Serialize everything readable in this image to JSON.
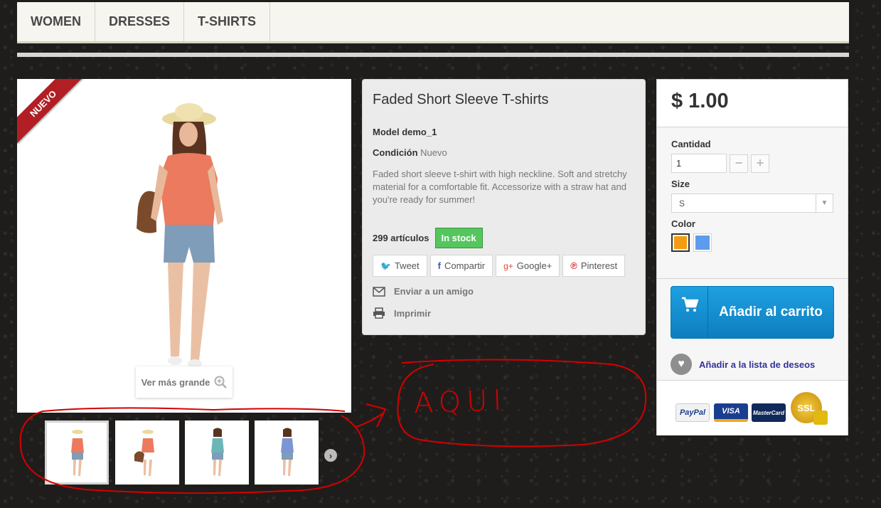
{
  "menu": {
    "items": [
      {
        "label": "WOMEN"
      },
      {
        "label": "DRESSES"
      },
      {
        "label": "T-SHIRTS"
      }
    ]
  },
  "image": {
    "ribbon": "NUEVO",
    "view_larger": "Ver más grande"
  },
  "product": {
    "title": "Faded Short Sleeve T-shirts",
    "model_label": "Model",
    "model_value": "demo_1",
    "condition_label": "Condición",
    "condition_value": "Nuevo",
    "description": "Faded short sleeve t-shirt with high neckline. Soft and stretchy material for a comfortable fit. Accessorize with a straw hat and you're ready for summer!",
    "quantity_text": "299 artículos",
    "stock_badge": "In stock",
    "stock_color": "#55c65e"
  },
  "social": {
    "tweet": "Tweet",
    "share": "Compartir",
    "google": "Google+",
    "pinterest": "Pinterest"
  },
  "actions": {
    "send_friend": "Enviar a un amigo",
    "print": "Imprimir"
  },
  "buy": {
    "price": "$ 1.00",
    "quantity_label": "Cantidad",
    "quantity_value": "1",
    "size_label": "Size",
    "size_value": "S",
    "color_label": "Color",
    "colors": [
      "#f39c11",
      "#5d9cec"
    ],
    "add_to_cart": "Añadir al carrito",
    "wishlist": "Añadir a la lista de deseos"
  },
  "payment": {
    "paypal": "PayPal",
    "visa": "VISA",
    "mastercard": "MasterCard",
    "ssl": "SSL"
  },
  "annotation": {
    "text": "AQUI",
    "color": "#d40000"
  }
}
